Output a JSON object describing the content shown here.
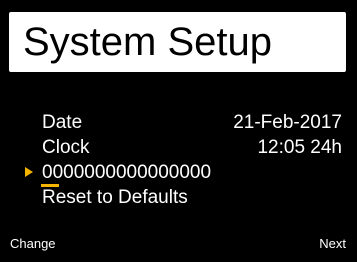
{
  "title": "System Setup",
  "menu": {
    "date": {
      "label": "Date",
      "value": "21-Feb-2017"
    },
    "clock": {
      "label": "Clock",
      "value": "12:05 24h"
    },
    "id_field": {
      "value": "0000000000000000"
    },
    "reset": {
      "label": "Reset to Defaults"
    }
  },
  "softkeys": {
    "left": "Change",
    "right": "Next"
  },
  "colors": {
    "background": "#000000",
    "title_bg": "#ffffff",
    "text": "#ffffff",
    "accent": "#f5b400"
  }
}
